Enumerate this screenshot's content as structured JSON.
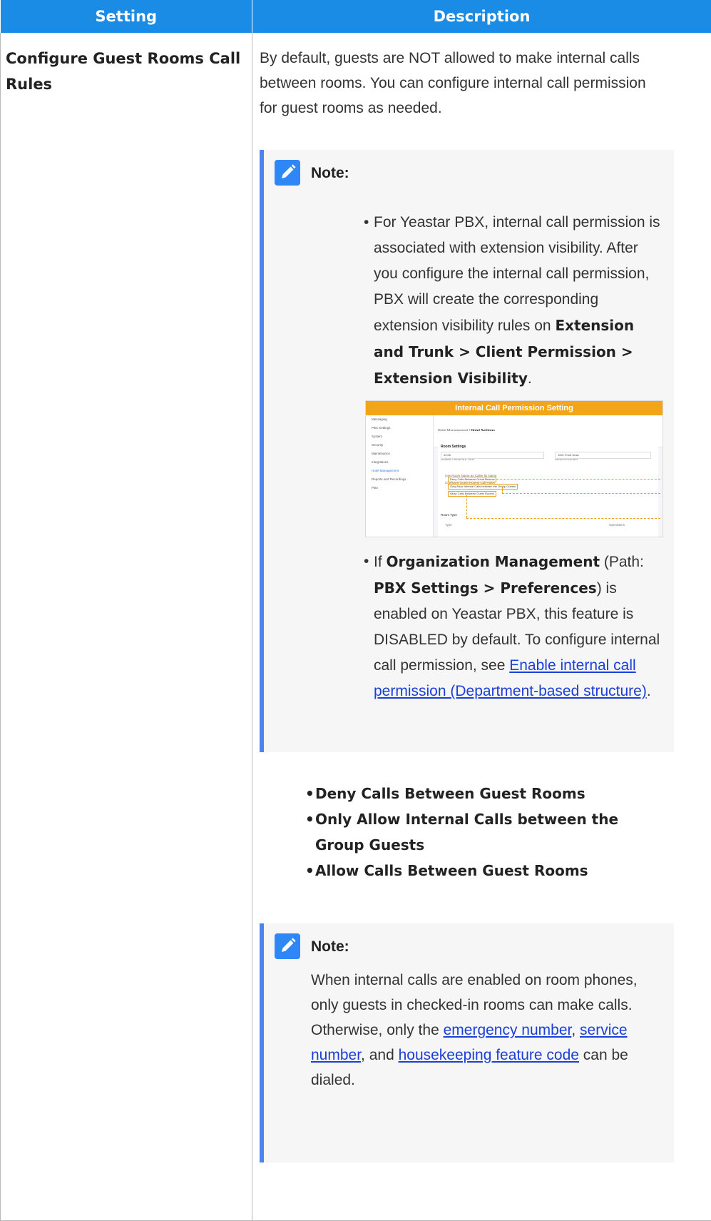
{
  "header": {
    "col_setting": "Setting",
    "col_description": "Description"
  },
  "setting": {
    "name": "Configure Guest Rooms Call Rules"
  },
  "description": {
    "intro": "By default, guests are NOT allowed to make internal calls between rooms. You can configure internal call permission for guest rooms as needed.",
    "note1": {
      "title": "Note:",
      "bullet1": {
        "text_a": "For Yeastar PBX, internal call permission is associated with extension visibility. After you configure the internal call permission, PBX will create the corresponding extension visibility rules on ",
        "path": "Extension and Trunk > Client Permission > Extension Visibility",
        "text_b": "."
      },
      "screenshot": {
        "header": "Internal Call Permission Setting",
        "sidebar": [
          "Messaging",
          "PBX Settings",
          "System",
          "Security",
          "Maintenance",
          "Integrations",
          "Hotel Management",
          "Reports and Recordings",
          "Plan"
        ],
        "breadcrumb_parent": "Hotel Management",
        "breadcrumb_current": "Hotel Settings",
        "panel_title": "Room Settings",
        "checkout_label": "Default Check-out Time",
        "checkout_value": "12:00",
        "service_label": "Service Number",
        "service_value": "1001 Front Desk",
        "caller_id_label": "Use Room Name as Caller ID Name",
        "call_rules_label": "Configure Guest Rooms Call Rules",
        "option1": "Deny Calls Between Guest Rooms",
        "option2": "Only Allow Internal Calls between the Group Guests",
        "option3": "Allow Calls Between Guest Rooms",
        "room_type_label": "Room Type",
        "col_type": "Type",
        "col_operations": "Operations"
      },
      "bullet2": {
        "text_a": "If ",
        "feature": "Organization Management",
        "text_b": " (Path: ",
        "path": "PBX Settings > Preferences",
        "text_c": ") is enabled on Yeastar PBX, this feature is DISABLED by default. To configure internal call permission, see ",
        "link": "Enable internal call permission (Department-based structure)",
        "text_d": "."
      }
    },
    "options": [
      "Deny Calls Between Guest Rooms",
      "Only Allow Internal Calls between the Group Guests",
      "Allow Calls Between Guest Rooms"
    ],
    "note2": {
      "title": "Note:",
      "text_a": "When internal calls are enabled on room phones, only guests in checked-in rooms can make calls. Otherwise, only the ",
      "link1": "emergency number",
      "sep1": ", ",
      "link2": "service number",
      "sep2": ", and ",
      "link3": "housekeeping feature code",
      "text_b": " can be dialed."
    }
  },
  "colors": {
    "header_bg": "#1a8ce6",
    "note_border": "#4a84f0",
    "note_icon": "#2f86f6",
    "screenshot_header": "#f3a51a",
    "link": "#1a3fd8"
  }
}
